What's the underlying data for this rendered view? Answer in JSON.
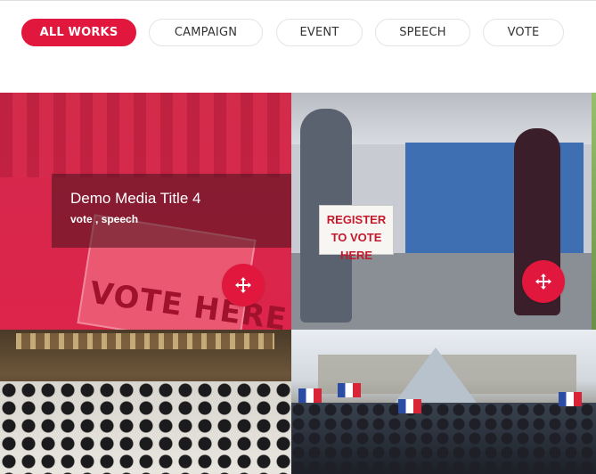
{
  "filters": [
    {
      "label": "ALL WORKS",
      "active": true
    },
    {
      "label": "CAMPAIGN",
      "active": false
    },
    {
      "label": "EVENT",
      "active": false
    },
    {
      "label": "SPEECH",
      "active": false
    },
    {
      "label": "VOTE",
      "active": false
    }
  ],
  "gallery": {
    "items": [
      {
        "title": "Demo Media Title 4",
        "tags": "vote , speech",
        "image_text": "VOTE HERE",
        "hover": true,
        "icon": "move-icon"
      },
      {
        "image_text": "REGISTER TO VOTE HERE",
        "hover": false,
        "icon": "move-icon"
      },
      {
        "hover": false
      },
      {
        "hover": false
      }
    ]
  },
  "colors": {
    "accent": "#e2173d",
    "overlay": "#e2173d"
  }
}
